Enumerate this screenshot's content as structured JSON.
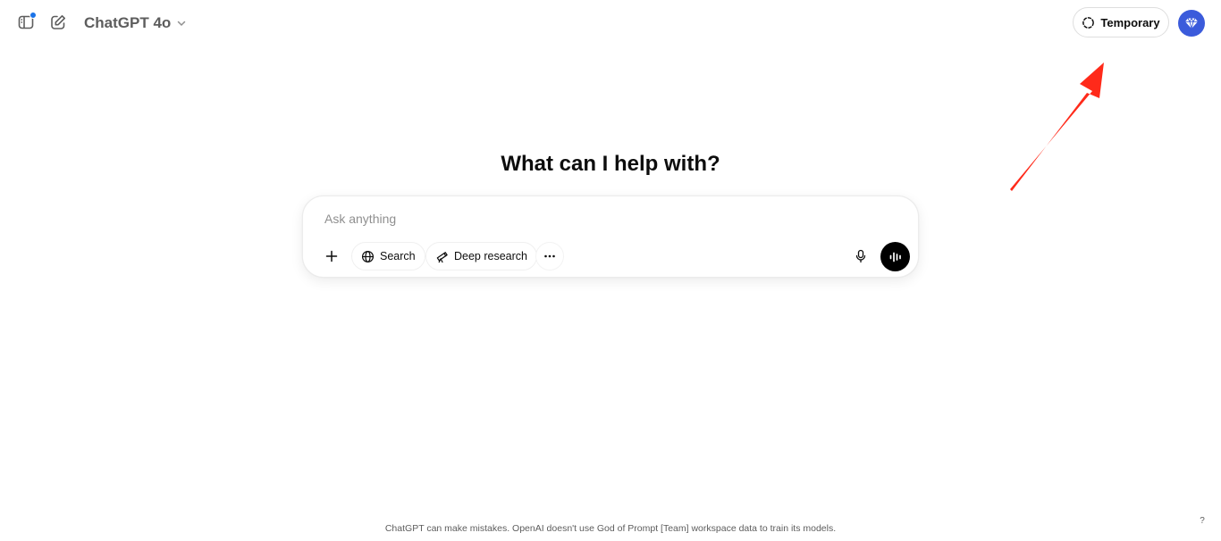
{
  "header": {
    "model_name": "ChatGPT 4o",
    "temporary_label": "Temporary"
  },
  "main": {
    "headline": "What can I help with?"
  },
  "composer": {
    "placeholder": "Ask anything",
    "tools": {
      "search_label": "Search",
      "deep_research_label": "Deep research"
    }
  },
  "footer": {
    "disclaimer": "ChatGPT can make mistakes. OpenAI doesn't use God of Prompt [Team] workspace data to train its models.",
    "help_label": "?"
  },
  "colors": {
    "avatar": "#3b5bdb",
    "notification_dot": "#1a73e8",
    "annotation_arrow": "#ff2a1a"
  },
  "icons": [
    "sidebar-toggle-icon",
    "new-chat-icon",
    "chevron-down-icon",
    "temporary-chat-icon",
    "diamond-icon",
    "plus-icon",
    "globe-icon",
    "telescope-icon",
    "more-icon",
    "microphone-icon",
    "voice-mode-icon"
  ]
}
